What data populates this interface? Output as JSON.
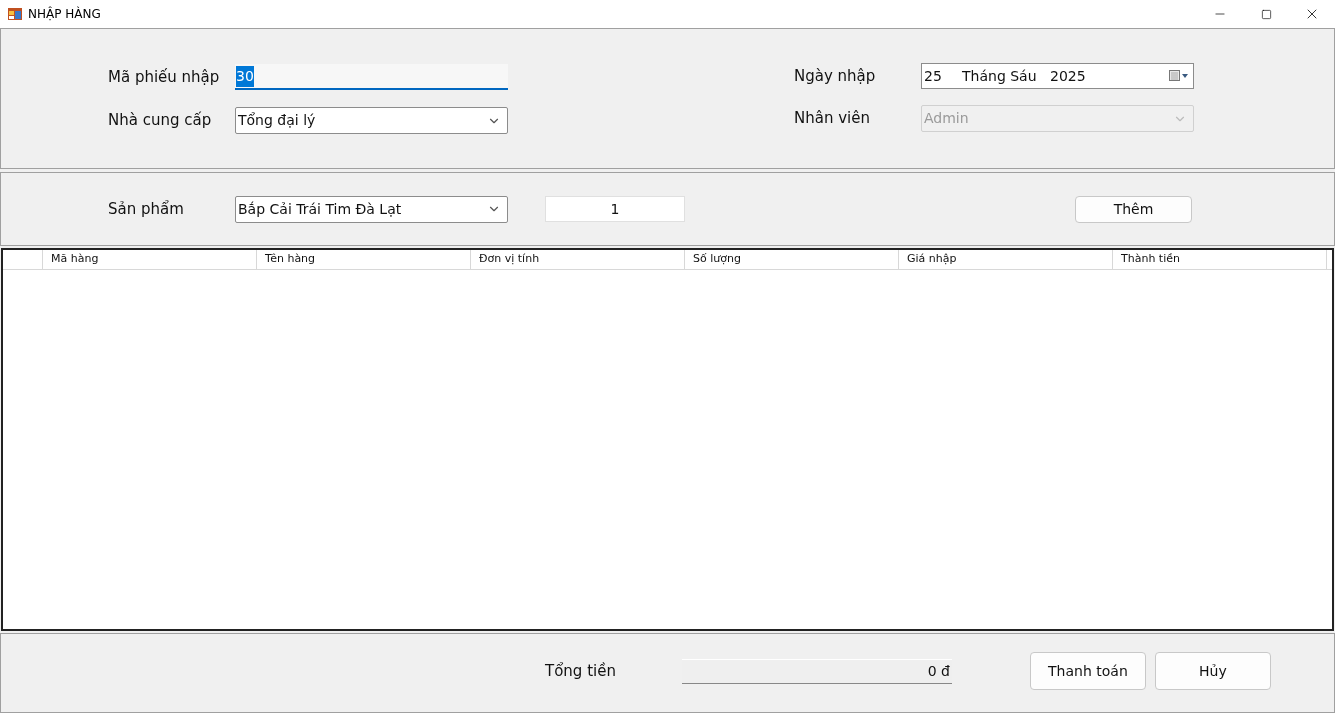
{
  "window": {
    "title": "NHẬP HÀNG"
  },
  "header": {
    "receipt_id": {
      "label": "Mã phiếu nhập",
      "value": "30",
      "focused": true
    },
    "supplier": {
      "label": "Nhà cung cấp",
      "value": "Tổng đại lý"
    },
    "date": {
      "label": "Ngày nhập",
      "day": "25",
      "month": "Tháng Sáu",
      "year": "2025"
    },
    "staff": {
      "label": "Nhân viên",
      "value": "Admin",
      "disabled": true
    }
  },
  "product_entry": {
    "label": "Sản phẩm",
    "product": "Bắp Cải Trái Tim Đà Lạt",
    "quantity": "1",
    "add_button": "Thêm"
  },
  "table": {
    "columns": [
      "Mã hàng",
      "Tên hàng",
      "Đơn vị tính",
      "Số lượng",
      "Giá nhập",
      "Thành tiền"
    ]
  },
  "footer": {
    "total_label": "Tổng tiền",
    "total": "0 đ",
    "buttons": [
      "Thanh toán",
      "Hủy"
    ]
  }
}
